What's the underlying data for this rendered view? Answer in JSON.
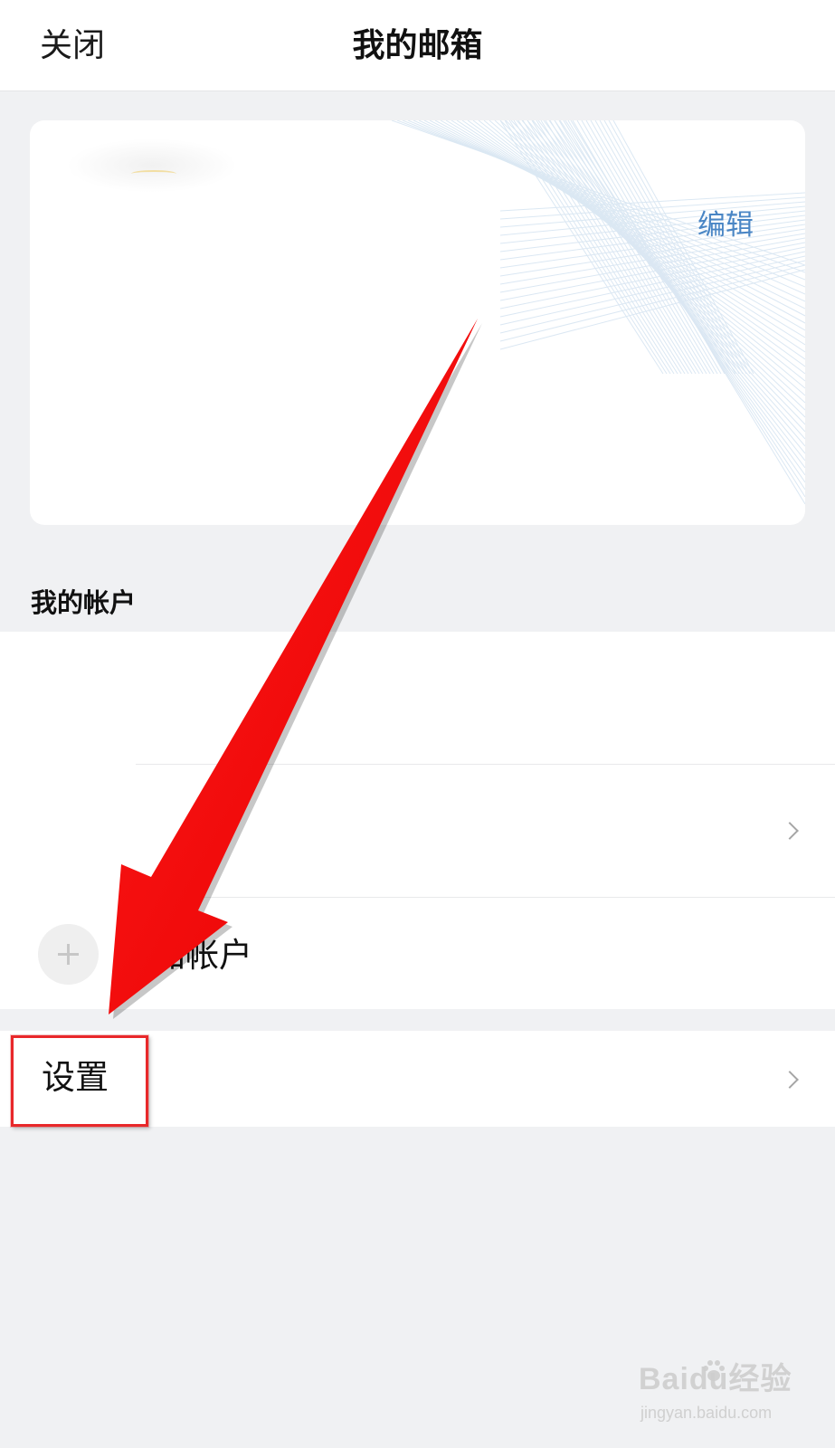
{
  "header": {
    "close_label": "关闭",
    "title": "我的邮箱"
  },
  "profile_card": {
    "edit_label": "编辑"
  },
  "accounts_section": {
    "heading": "我的帐户",
    "add_account_label": "加帐户"
  },
  "settings": {
    "label": "设置"
  },
  "annotation": {
    "arrow_color": "#f40000",
    "highlight_color": "#e8282a"
  },
  "watermark": {
    "brand": "Baidu经验",
    "url": "jingyan.baidu.com"
  },
  "colors": {
    "accent": "#4a86c5",
    "background": "#f0f1f3"
  }
}
